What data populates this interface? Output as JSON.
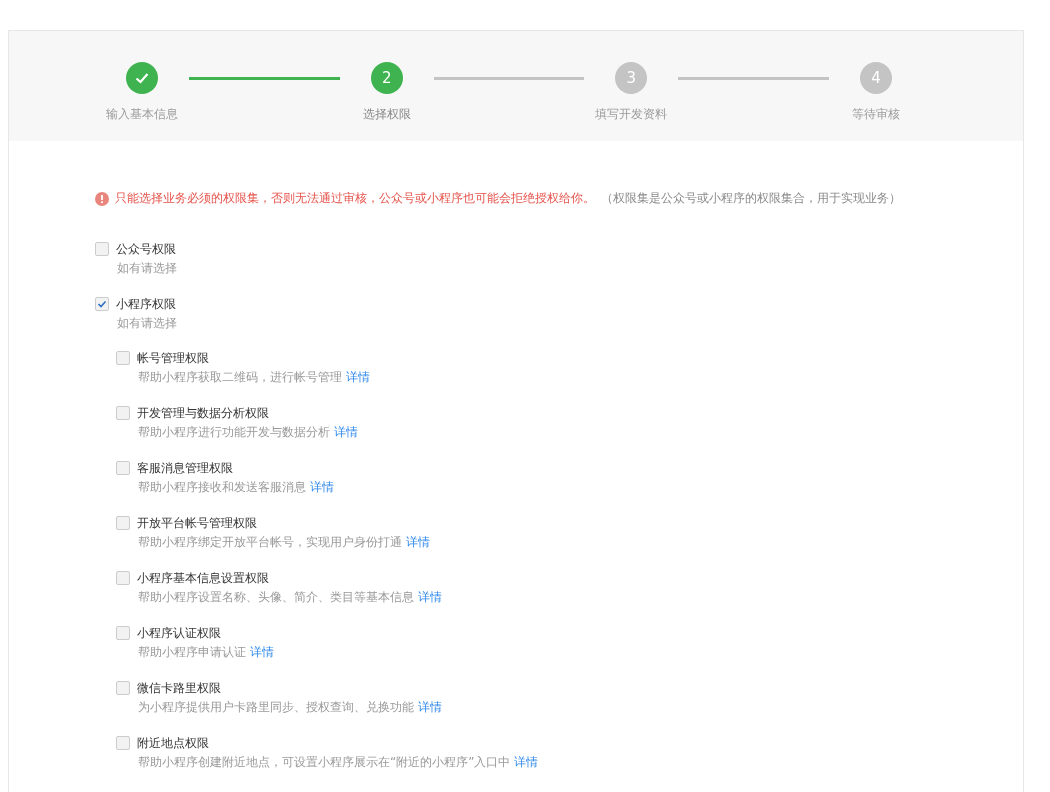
{
  "steps": [
    {
      "label": "输入基本信息",
      "completed": true,
      "selected": false
    },
    {
      "number": "2",
      "label": "选择权限",
      "completed": false,
      "selected": true
    },
    {
      "number": "3",
      "label": "填写开发资料",
      "completed": false,
      "selected": false
    },
    {
      "number": "4",
      "label": "等待审核",
      "completed": false,
      "selected": false
    }
  ],
  "notice": {
    "text": "只能选择业务必须的权限集，否则无法通过审核，公众号或小程序也可能会拒绝授权给你。",
    "note": "（权限集是公众号或小程序的权限集合，用于实现业务）"
  },
  "groups": [
    {
      "label": "公众号权限",
      "hint": "如有请选择",
      "checked": false
    },
    {
      "label": "小程序权限",
      "hint": "如有请选择",
      "checked": true,
      "children": [
        {
          "label": "帐号管理权限",
          "description": "帮助小程序获取二维码，进行帐号管理",
          "link": "详情",
          "checked": false
        },
        {
          "label": "开发管理与数据分析权限",
          "description": "帮助小程序进行功能开发与数据分析",
          "link": "详情",
          "checked": false
        },
        {
          "label": "客服消息管理权限",
          "description": "帮助小程序接收和发送客服消息",
          "link": "详情",
          "checked": false
        },
        {
          "label": "开放平台帐号管理权限",
          "description": "帮助小程序绑定开放平台帐号，实现用户身份打通",
          "link": "详情",
          "checked": false
        },
        {
          "label": "小程序基本信息设置权限",
          "description": "帮助小程序设置名称、头像、简介、类目等基本信息",
          "link": "详情",
          "checked": false
        },
        {
          "label": "小程序认证权限",
          "description": "帮助小程序申请认证",
          "link": "详情",
          "checked": false
        },
        {
          "label": "微信卡路里权限",
          "description": "为小程序提供用户卡路里同步、授权查询、兑换功能",
          "link": "详情",
          "checked": false
        },
        {
          "label": "附近地点权限",
          "description": "帮助小程序创建附近地点，可设置小程序展示在“附近的小程序”入口中",
          "link": "详情",
          "checked": false
        }
      ]
    }
  ]
}
